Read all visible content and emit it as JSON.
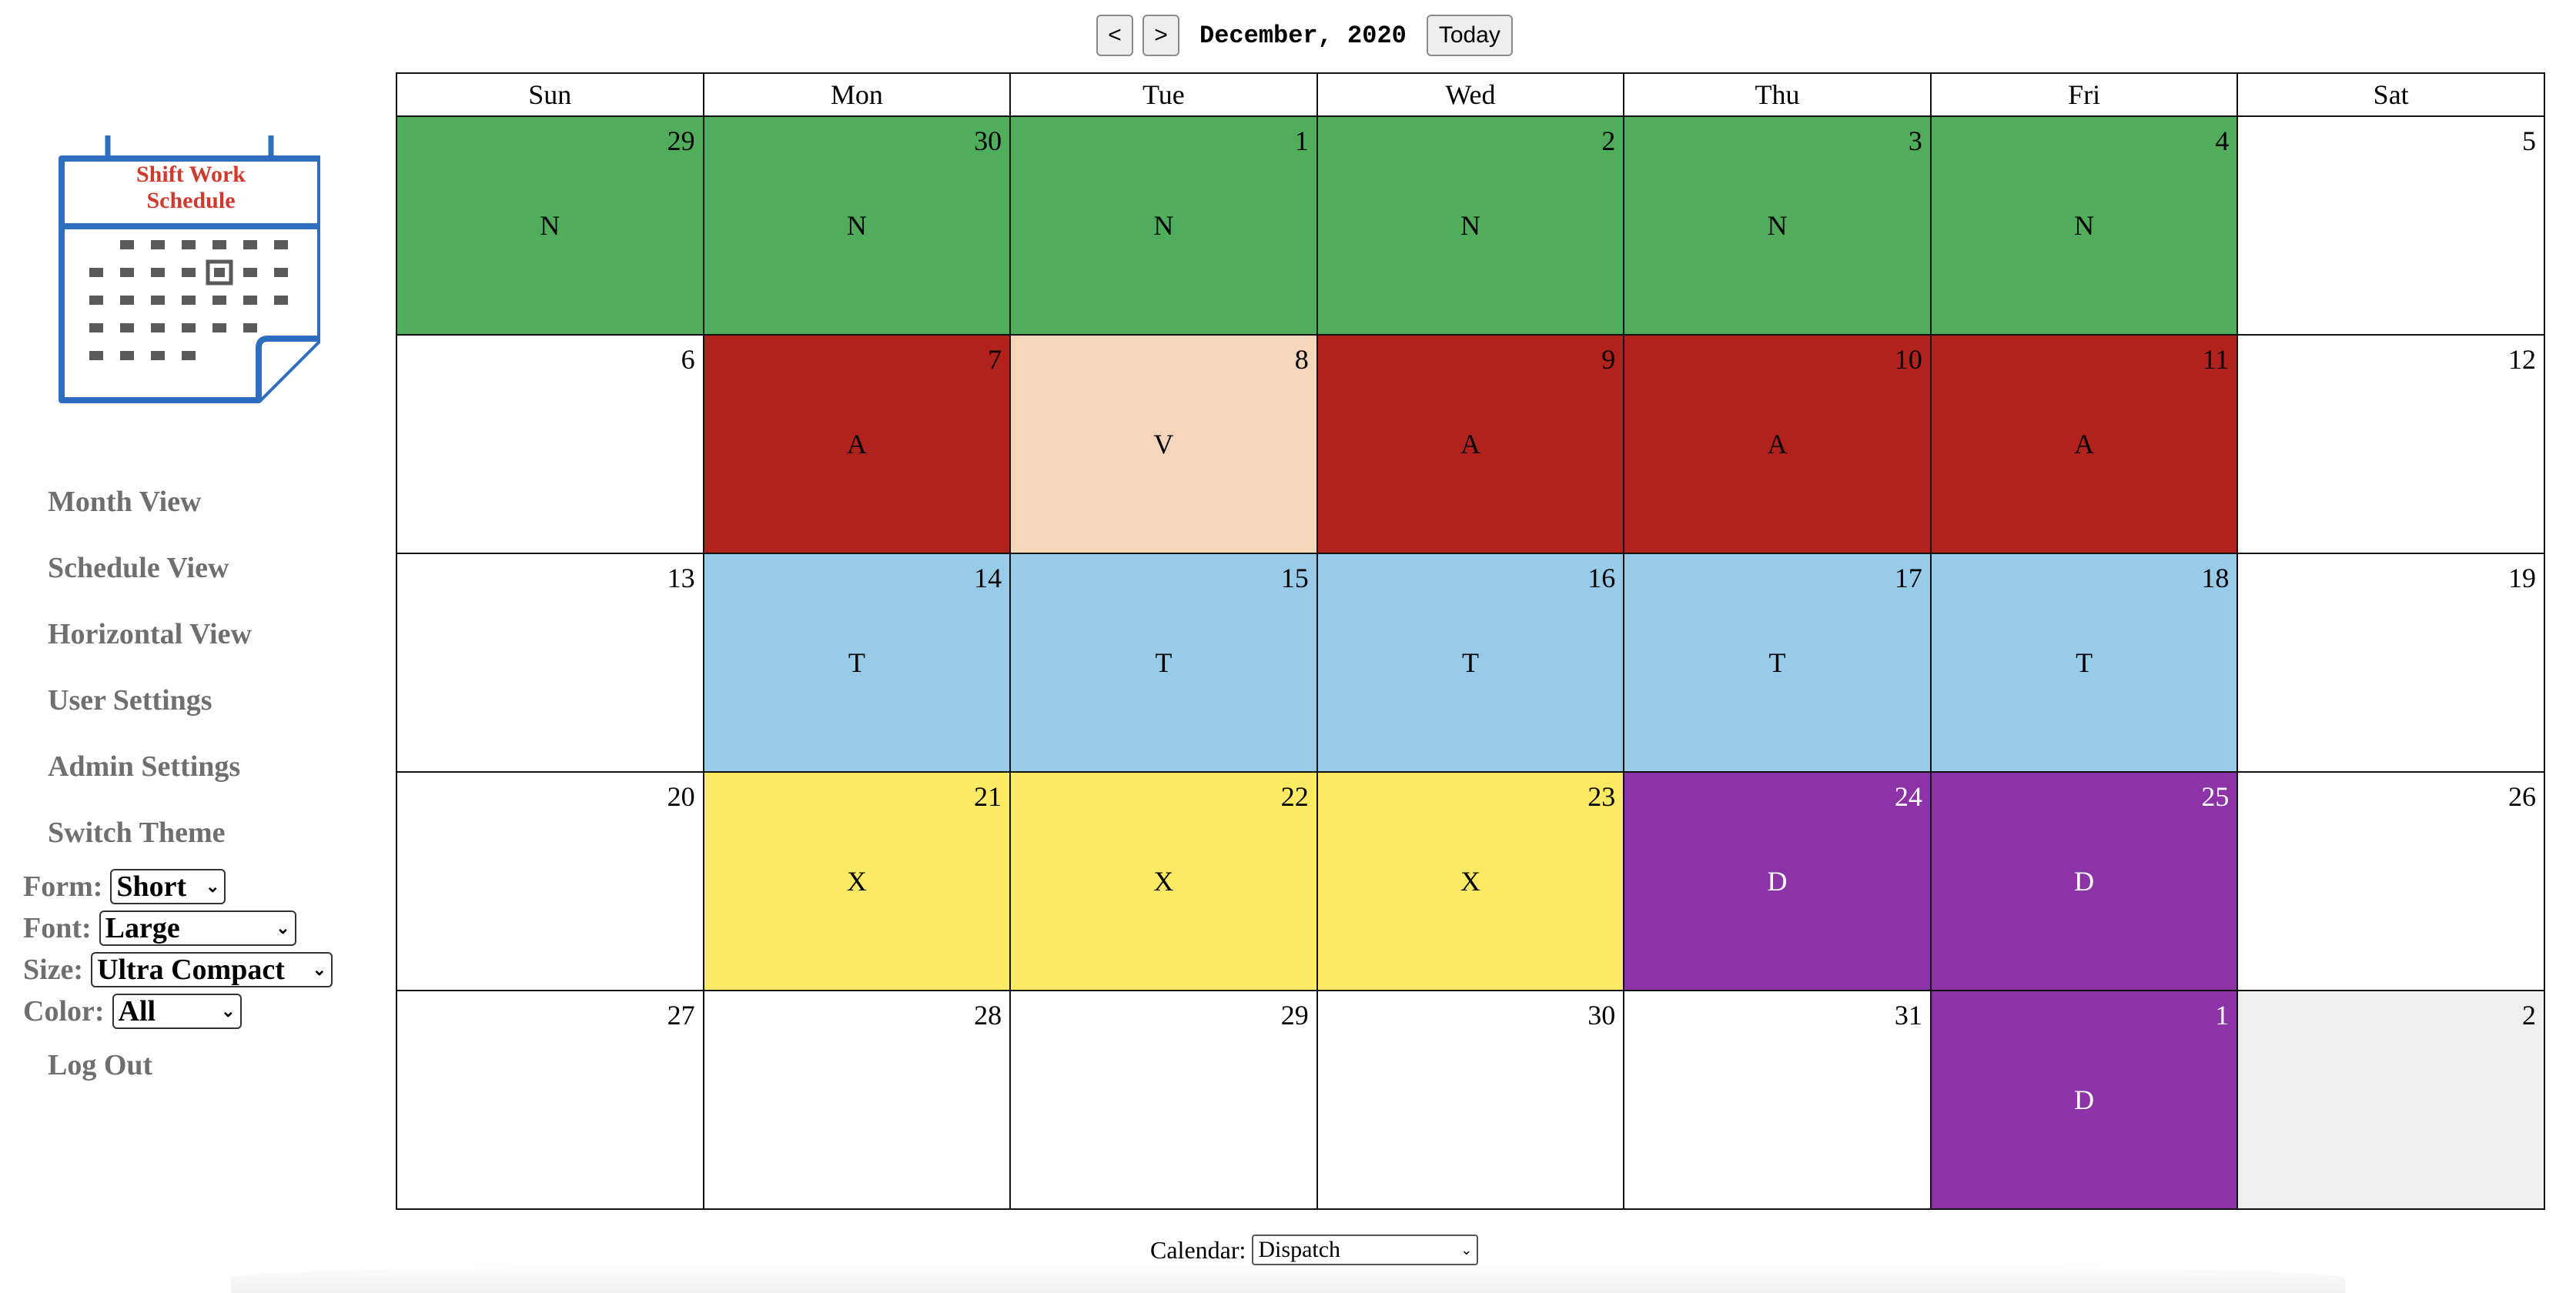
{
  "logo": {
    "line1": "Shift Work",
    "line2": "Schedule"
  },
  "nav": {
    "month_view": "Month View",
    "schedule_view": "Schedule View",
    "horizontal_view": "Horizontal View",
    "user_settings": "User Settings",
    "admin_settings": "Admin Settings",
    "switch_theme": "Switch Theme",
    "log_out": "Log Out"
  },
  "options": {
    "form_label": "Form:",
    "form_value": "Short",
    "font_label": "Font:",
    "font_value": "Large",
    "size_label": "Size:",
    "size_value": "Ultra Compact",
    "color_label": "Color:",
    "color_value": "All"
  },
  "toolbar": {
    "prev": "<",
    "next": ">",
    "month": "December, 2020",
    "today": "Today"
  },
  "weekdays": [
    "Sun",
    "Mon",
    "Tue",
    "Wed",
    "Thu",
    "Fri",
    "Sat"
  ],
  "colors": {
    "N": "#4fad5b",
    "A": "#b2221c",
    "V": "#f5d6bb",
    "T": "#98cbe8",
    "X": "#fce964",
    "D": "#8c33a8"
  },
  "weeks": [
    [
      {
        "day": "29",
        "code": "N"
      },
      {
        "day": "30",
        "code": "N"
      },
      {
        "day": "1",
        "code": "N"
      },
      {
        "day": "2",
        "code": "N"
      },
      {
        "day": "3",
        "code": "N"
      },
      {
        "day": "4",
        "code": "N"
      },
      {
        "day": "5",
        "code": ""
      }
    ],
    [
      {
        "day": "6",
        "code": ""
      },
      {
        "day": "7",
        "code": "A"
      },
      {
        "day": "8",
        "code": "V"
      },
      {
        "day": "9",
        "code": "A"
      },
      {
        "day": "10",
        "code": "A"
      },
      {
        "day": "11",
        "code": "A"
      },
      {
        "day": "12",
        "code": ""
      }
    ],
    [
      {
        "day": "13",
        "code": ""
      },
      {
        "day": "14",
        "code": "T"
      },
      {
        "day": "15",
        "code": "T"
      },
      {
        "day": "16",
        "code": "T"
      },
      {
        "day": "17",
        "code": "T"
      },
      {
        "day": "18",
        "code": "T"
      },
      {
        "day": "19",
        "code": ""
      }
    ],
    [
      {
        "day": "20",
        "code": ""
      },
      {
        "day": "21",
        "code": "X"
      },
      {
        "day": "22",
        "code": "X"
      },
      {
        "day": "23",
        "code": "X"
      },
      {
        "day": "24",
        "code": "D"
      },
      {
        "day": "25",
        "code": "D"
      },
      {
        "day": "26",
        "code": ""
      }
    ],
    [
      {
        "day": "27",
        "code": ""
      },
      {
        "day": "28",
        "code": ""
      },
      {
        "day": "29",
        "code": ""
      },
      {
        "day": "30",
        "code": ""
      },
      {
        "day": "31",
        "code": ""
      },
      {
        "day": "1",
        "code": "D"
      },
      {
        "day": "2",
        "code": "",
        "outside": true
      }
    ]
  ],
  "footer": {
    "calendar_label": "Calendar:",
    "calendar_value": "Dispatch"
  }
}
